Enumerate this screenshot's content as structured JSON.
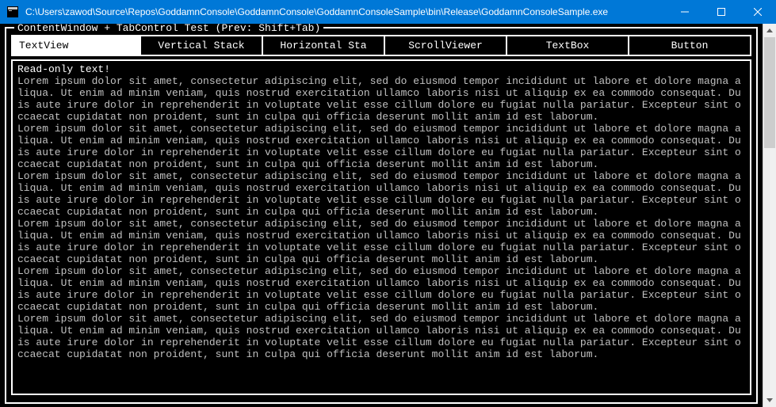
{
  "titlebar": {
    "path": "C:\\Users\\zawod\\Source\\Repos\\GoddamnConsole\\GoddamnConsole\\GoddamnConsoleSample\\bin\\Release\\GoddamnConsoleSample.exe"
  },
  "frame": {
    "title": " ContentWindow + TabControl Test (Prev: Shift+Tab) "
  },
  "tabs": [
    {
      "label": "TextView",
      "active": true
    },
    {
      "label": "Vertical Stack",
      "active": false
    },
    {
      "label": "Horizontal Sta",
      "active": false
    },
    {
      "label": "ScrollViewer",
      "active": false
    },
    {
      "label": "TextBox",
      "active": false
    },
    {
      "label": "Button",
      "active": false
    }
  ],
  "content": {
    "header": "Read-only text!",
    "paragraph": "Lorem ipsum dolor sit amet, consectetur adipiscing elit, sed do eiusmod tempor incididunt ut labore et dolore magna aliqua. Ut enim ad minim veniam, quis nostrud exercitation ullamco laboris nisi ut aliquip ex ea commodo consequat. Duis aute irure dolor in reprehenderit in voluptate velit esse cillum dolore eu fugiat nulla pariatur. Excepteur sint occaecat cupidatat non proident, sunt in culpa qui officia deserunt mollit anim id est laborum.",
    "repeat": 6
  }
}
